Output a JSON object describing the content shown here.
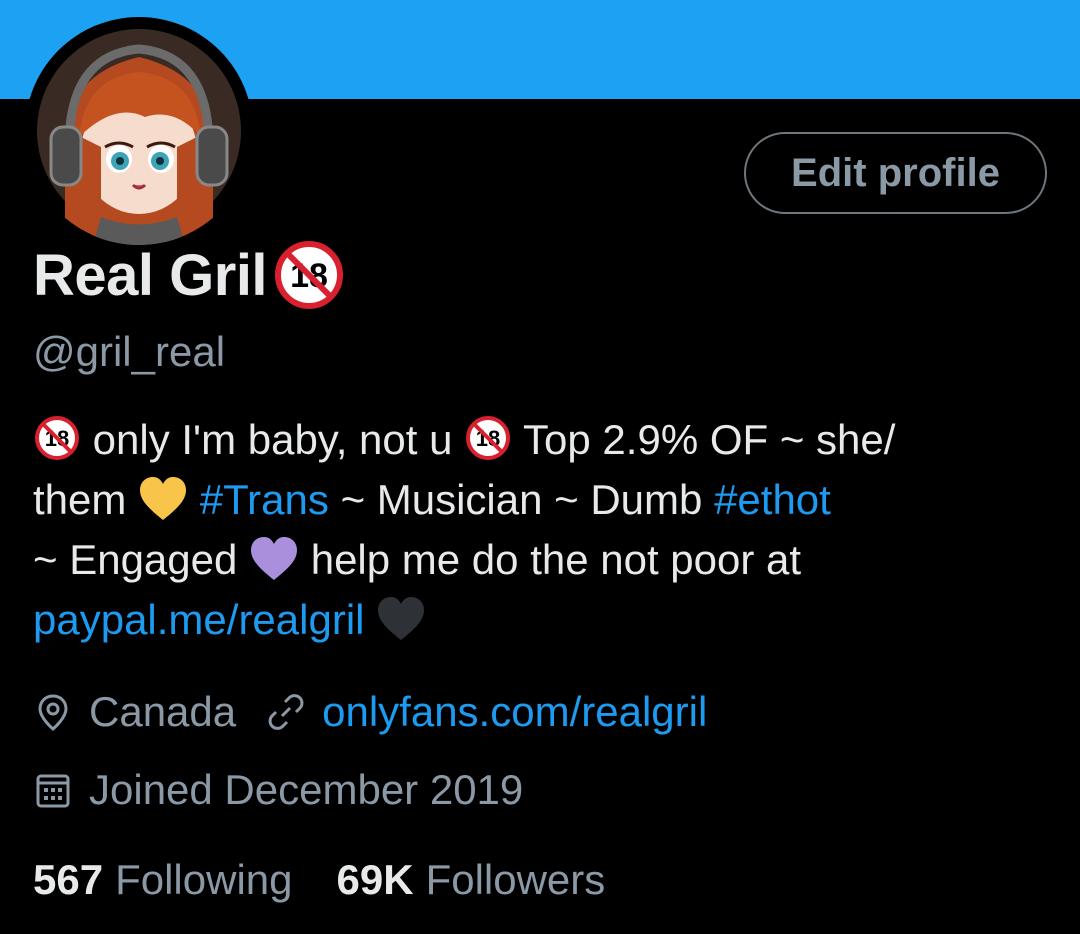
{
  "profile": {
    "display_name": "Real Gril",
    "handle": "@gril_real",
    "edit_button_label": "Edit profile",
    "badge_text": "18",
    "bio": {
      "l1_a": "only I'm baby, not u",
      "l1_b": "Top 2.9% OF ~ she/",
      "l2_a": "them",
      "l2_hashtag1": "#Trans",
      "l2_b": "~ Musician ~ Dumb",
      "l2_hashtag2": "#ethot",
      "l3_a": "~ Engaged",
      "l3_b": "help me do the not poor at",
      "l4_link": "paypal.me/realgril"
    },
    "location": "Canada",
    "website": "onlyfans.com/realgril",
    "joined": "Joined December 2019",
    "following_count": "567",
    "following_label": "Following",
    "followers_count": "69K",
    "followers_label": "Followers"
  },
  "icons": {
    "location": "location-pin-icon",
    "link": "link-icon",
    "calendar": "calendar-icon",
    "no-under-18": "no-under-18-emoji",
    "yellow-heart": "yellow-heart-emoji",
    "purple-heart": "purple-heart-emoji",
    "black-heart": "black-heart-emoji"
  },
  "colors": {
    "banner": "#1da1f2",
    "background": "#000000",
    "link": "#1d9bf0",
    "muted": "#8b98a5",
    "text": "#e7e9ea"
  }
}
